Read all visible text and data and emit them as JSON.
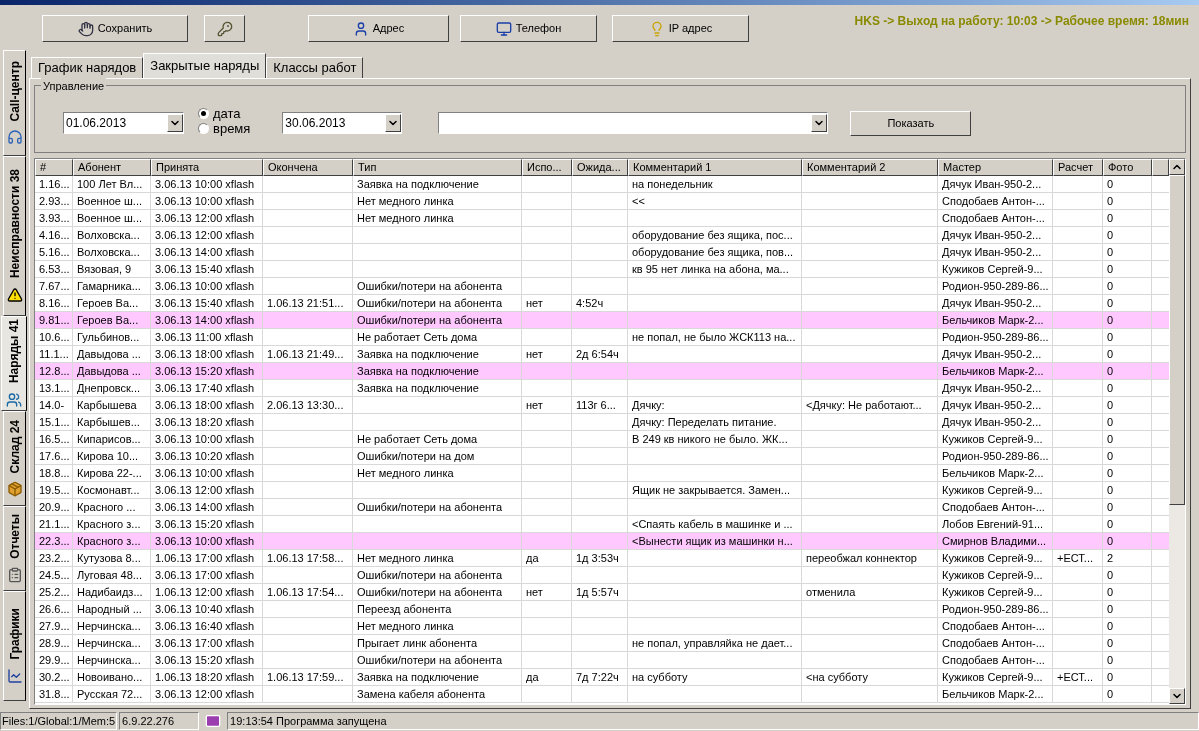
{
  "toolbar": {
    "buttons": [
      {
        "label": "Сохранить",
        "kind": "save"
      },
      {
        "kind": "keys"
      },
      {
        "label": "Адрес",
        "kind": "address"
      },
      {
        "label": "Телефон",
        "kind": "phone"
      },
      {
        "label": "IP адрес",
        "kind": "ip"
      }
    ],
    "status_text": "HKS -> Выход на работу: 10:03 -> Рабочее время: 18мин"
  },
  "sidebar": {
    "tabs": [
      {
        "label": "Call-центр",
        "kind": "call",
        "selected": false
      },
      {
        "label": "Неисправности 38",
        "kind": "faults",
        "selected": false
      },
      {
        "label": "Наряды 41",
        "kind": "orders",
        "selected": true
      },
      {
        "label": "Склад 24",
        "kind": "stock",
        "selected": false
      },
      {
        "label": "Отчеты",
        "kind": "reports",
        "selected": false
      },
      {
        "label": "Графики",
        "kind": "charts",
        "selected": false
      }
    ]
  },
  "tabs": [
    {
      "label": "График нарядов",
      "selected": false
    },
    {
      "label": "Закрытые наряды",
      "selected": true
    },
    {
      "label": "Классы работ",
      "selected": false
    }
  ],
  "controls": {
    "title": "Управление",
    "date_from": "01.06.2013",
    "date_to": "30.06.2013",
    "radios": [
      {
        "label": "дата",
        "selected": true
      },
      {
        "label": "время",
        "selected": false
      }
    ],
    "show_button": "Показать"
  },
  "table": {
    "columns": [
      "#",
      "Абонент",
      "Принята",
      "Окончена",
      "Тип",
      "Испо...",
      "Ожида...",
      "Комментарий 1",
      "Комментарий 2",
      "Мастер",
      "Расчет",
      "Фото"
    ],
    "rows": [
      {
        "highlighted": false,
        "cells": [
          "1.16...",
          "100 Лет Вл...",
          "3.06.13 10:00 xflash",
          null,
          "Заявка на подключение",
          null,
          null,
          "на понедельник",
          null,
          "Дячук Иван-950-2...",
          null,
          "0"
        ]
      },
      {
        "highlighted": false,
        "cells": [
          "2.93...",
          "Военное ш...",
          "3.06.13 10:00 xflash",
          null,
          "Нет медного линка",
          null,
          null,
          "<<",
          null,
          "Сподобаев Антон-...",
          null,
          "0"
        ]
      },
      {
        "highlighted": false,
        "cells": [
          "3.93...",
          "Военное ш...",
          "3.06.13 12:00 xflash",
          null,
          "Нет медного линка",
          null,
          null,
          null,
          null,
          "Сподобаев Антон-...",
          null,
          "0"
        ]
      },
      {
        "highlighted": false,
        "cells": [
          "4.16...",
          "Волховска...",
          "3.06.13 12:00 xflash",
          null,
          null,
          null,
          null,
          "оборудование без ящика, пос...",
          null,
          "Дячук Иван-950-2...",
          null,
          "0"
        ]
      },
      {
        "highlighted": false,
        "cells": [
          "5.16...",
          "Волховска...",
          "3.06.13 14:00 xflash",
          null,
          null,
          null,
          null,
          "оборудование без ящика, пов...",
          null,
          "Дячук Иван-950-2...",
          null,
          "0"
        ]
      },
      {
        "highlighted": false,
        "cells": [
          "6.53...",
          "Вязовая, 9",
          "3.06.13 15:40 xflash",
          null,
          null,
          null,
          null,
          "кв 95 нет линка на абона, ма...",
          null,
          "Кужиков Сергей-9...",
          null,
          "0"
        ]
      },
      {
        "highlighted": false,
        "cells": [
          "7.67...",
          "Гамарника...",
          "3.06.13 10:00 xflash",
          null,
          "Ошибки/потери на абонента",
          null,
          null,
          null,
          null,
          "Родион-950-289-86...",
          null,
          "0"
        ]
      },
      {
        "highlighted": false,
        "cells": [
          "8.16...",
          "Героев Ва...",
          "3.06.13 15:40 xflash",
          "1.06.13 21:51...",
          "Ошибки/потери на абонента",
          "нет",
          "4:52ч",
          null,
          null,
          "Дячук Иван-950-2...",
          null,
          "0"
        ]
      },
      {
        "highlighted": true,
        "cells": [
          "9.81...",
          "Героев Ва...",
          "3.06.13 14:00 xflash",
          null,
          "Ошибки/потери на абонента",
          null,
          null,
          null,
          null,
          "Бельчиков Марк-2...",
          null,
          "0"
        ]
      },
      {
        "highlighted": false,
        "cells": [
          "10.6...",
          "Гульбинов...",
          "3.06.13 11:00 xflash",
          null,
          "Не работает Сеть дома",
          null,
          null,
          "не попал, не было ЖСК113 на...",
          null,
          "Родион-950-289-86...",
          null,
          "0"
        ]
      },
      {
        "highlighted": false,
        "cells": [
          "11.1...",
          "Давыдова ...",
          "3.06.13 18:00 xflash",
          "1.06.13 21:49...",
          "Заявка на подключение",
          "нет",
          "2д 6:54ч",
          null,
          null,
          "Дячук Иван-950-2...",
          null,
          "0"
        ]
      },
      {
        "highlighted": true,
        "cells": [
          "12.8...",
          "Давыдова ...",
          "3.06.13 15:20 xflash",
          null,
          "Заявка на подключение",
          null,
          null,
          null,
          null,
          "Бельчиков Марк-2...",
          null,
          "0"
        ]
      },
      {
        "highlighted": false,
        "cells": [
          "13.1...",
          "Днепровск...",
          "3.06.13 17:40 xflash",
          null,
          "Заявка на подключение",
          null,
          null,
          null,
          null,
          "Дячук Иван-950-2...",
          null,
          "0"
        ]
      },
      {
        "highlighted": false,
        "cells": [
          "14.0-",
          "Карбышева",
          "3.06.13 18:00 xflash",
          "2.06.13 13:30...",
          null,
          "нет",
          "113г 6...",
          "Дячку:",
          "<Дячку: Не работают...",
          "Дячук Иван-950-2...",
          null,
          "0"
        ]
      },
      {
        "highlighted": false,
        "cells": [
          "15.1...",
          "Карбышев...",
          "3.06.13 18:20 xflash",
          null,
          null,
          null,
          null,
          "Дячку: Переделать питание.",
          null,
          "Дячук Иван-950-2...",
          null,
          "0"
        ]
      },
      {
        "highlighted": false,
        "cells": [
          "16.5...",
          "Кипарисов...",
          "3.06.13 10:00 xflash",
          null,
          "Не работает Сеть дома",
          null,
          null,
          "В 249 кв никого не было. ЖК...",
          null,
          "Кужиков Сергей-9...",
          null,
          "0"
        ]
      },
      {
        "highlighted": false,
        "cells": [
          "17.6...",
          "Кирова 10...",
          "3.06.13 10:20 xflash",
          null,
          "Ошибки/потери на дом",
          null,
          null,
          null,
          null,
          "Родион-950-289-86...",
          null,
          "0"
        ]
      },
      {
        "highlighted": false,
        "cells": [
          "18.8...",
          "Кирова 22-...",
          "3.06.13 10:00 xflash",
          null,
          "Нет медного линка",
          null,
          null,
          null,
          null,
          "Бельчиков Марк-2...",
          null,
          "0"
        ]
      },
      {
        "highlighted": false,
        "cells": [
          "19.5...",
          "Космонавт...",
          "3.06.13 12:00 xflash",
          null,
          null,
          null,
          null,
          "Ящик не закрывается. Замен...",
          null,
          "Кужиков Сергей-9...",
          null,
          "0"
        ]
      },
      {
        "highlighted": false,
        "cells": [
          "20.9...",
          "Красного ...",
          "3.06.13 14:00 xflash",
          null,
          "Ошибки/потери на абонента",
          null,
          null,
          null,
          null,
          "Сподобаев Антон-...",
          null,
          "0"
        ]
      },
      {
        "highlighted": false,
        "cells": [
          "21.1...",
          "Красного з...",
          "3.06.13 15:20 xflash",
          null,
          null,
          null,
          null,
          "<Спаять кабель в машинке и ...",
          null,
          "Лобов Евгений-91...",
          null,
          "0"
        ]
      },
      {
        "highlighted": true,
        "cells": [
          "22.3...",
          "Красного з...",
          "3.06.13 10:00 xflash",
          null,
          null,
          null,
          null,
          "<Вынести ящик из машинки н...",
          null,
          "Смирнов Владими...",
          null,
          "0"
        ]
      },
      {
        "highlighted": false,
        "cells": [
          "23.2...",
          "Кутузова 8...",
          "1.06.13 17:00 xflash",
          "1.06.13 17:58...",
          "Нет медного линка",
          "да",
          "1д 3:53ч",
          null,
          "переобжал коннектор",
          "Кужиков Сергей-9...",
          "+ЕСТ...",
          "2"
        ]
      },
      {
        "highlighted": false,
        "cells": [
          "24.5...",
          "Луговая 48...",
          "3.06.13 17:00 xflash",
          null,
          "Ошибки/потери на абонента",
          null,
          null,
          null,
          null,
          "Кужиков Сергей-9...",
          null,
          "0"
        ]
      },
      {
        "highlighted": false,
        "cells": [
          "25.2...",
          "Надибаидз...",
          "1.06.13 12:00 xflash",
          "1.06.13 17:54...",
          "Ошибки/потери на абонента",
          "нет",
          "1д 5:57ч",
          null,
          "отменила",
          "Кужиков Сергей-9...",
          null,
          "0"
        ]
      },
      {
        "highlighted": false,
        "cells": [
          "26.6...",
          "Народный ...",
          "3.06.13 10:40 xflash",
          null,
          "Переезд абонента",
          null,
          null,
          null,
          null,
          "Родион-950-289-86...",
          null,
          "0"
        ]
      },
      {
        "highlighted": false,
        "cells": [
          "27.9...",
          "Нерчинска...",
          "3.06.13 16:40 xflash",
          null,
          "Нет медного линка",
          null,
          null,
          null,
          null,
          "Сподобаев Антон-...",
          null,
          "0"
        ]
      },
      {
        "highlighted": false,
        "cells": [
          "28.9...",
          "Нерчинска...",
          "3.06.13 17:00 xflash",
          null,
          "Прыгает линк абонента",
          null,
          null,
          "не попал, управляйка не дает...",
          null,
          "Сподобаев Антон-...",
          null,
          "0"
        ]
      },
      {
        "highlighted": false,
        "cells": [
          "29.9...",
          "Нерчинска...",
          "3.06.13 15:20 xflash",
          null,
          "Ошибки/потери на абонента",
          null,
          null,
          null,
          null,
          "Сподобаев Антон-...",
          null,
          "0"
        ]
      },
      {
        "highlighted": false,
        "cells": [
          "30.2...",
          "Новоивано...",
          "1.06.13 18:20 xflash",
          "1.06.13 17:59...",
          "Заявка на подключение",
          "да",
          "7д 7:22ч",
          "на субботу",
          "<на субботу",
          "Кужиков Сергей-9...",
          "+ЕСТ...",
          "0"
        ]
      },
      {
        "highlighted": false,
        "cells": [
          "31.8...",
          "Русская 72...",
          "3.06.13 12:00 xflash",
          null,
          "Замена кабеля абонента",
          null,
          null,
          null,
          null,
          "Бельчиков Марк-2...",
          null,
          "0"
        ]
      }
    ]
  },
  "status_bar": {
    "memory": "Files:1/Global:1/Mem:5",
    "version": "6.9.22.276",
    "message": "19:13:54 Программа запущена"
  }
}
